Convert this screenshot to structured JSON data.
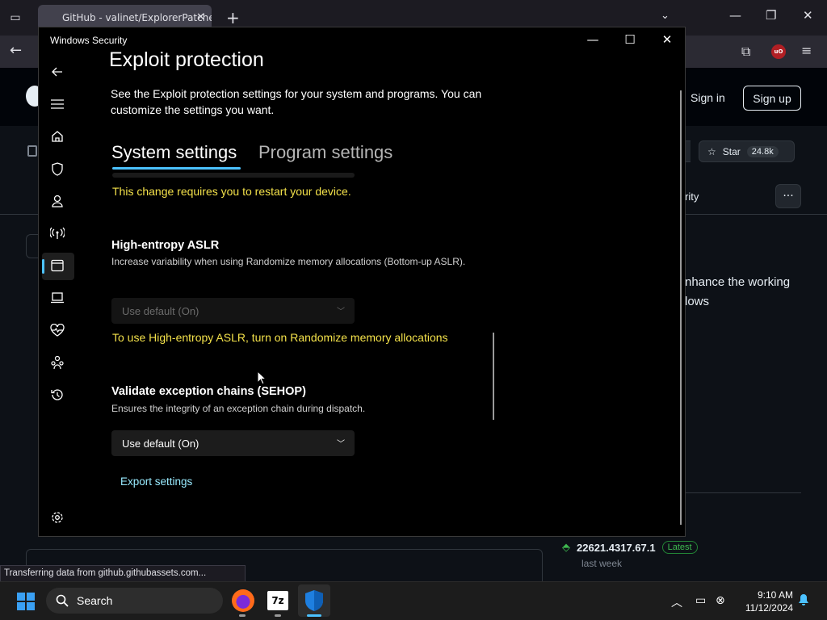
{
  "browser": {
    "tab_title": "GitHub - valinet/ExplorerPatcher",
    "tab_close": "✕",
    "new_tab": "+",
    "status_text": "Transferring data from github.githubassets.com..."
  },
  "github": {
    "signin_label": "Sign in",
    "signup_label": "Sign up",
    "star_label": "Star",
    "star_count": "24.8k",
    "partial_tab": "rity",
    "description_partial": "nhance the working lows",
    "release_version": "22621.4317.67.1",
    "release_badge": "Latest",
    "release_date": "last week"
  },
  "windows_security": {
    "window_title": "Windows Security",
    "page_title": "Exploit protection",
    "intro": "See the Exploit protection settings for your system and programs.  You can customize the settings you want.",
    "tabs": [
      {
        "label": "System settings",
        "active": true
      },
      {
        "label": "Program settings",
        "active": false
      }
    ],
    "restart_warning": "This change requires you to restart your device.",
    "settings": [
      {
        "title": "High-entropy ASLR",
        "description": "Increase variability when using Randomize memory allocations (Bottom-up ASLR).",
        "value": "Use default (On)",
        "disabled": true,
        "note": "To use High-entropy ASLR, turn on Randomize memory allocations"
      },
      {
        "title": "Validate exception chains (SEHOP)",
        "description": "Ensures the integrity of an exception chain during dispatch.",
        "value": "Use default (On)",
        "disabled": false
      }
    ],
    "export_link": "Export settings",
    "nav_icons": [
      "back-arrow-icon",
      "hamburger-menu-icon",
      "home-icon",
      "shield-icon",
      "account-icon",
      "network-icon",
      "app-browser-control-icon",
      "device-security-icon",
      "health-heart-icon",
      "family-icon",
      "history-icon",
      "settings-gear-icon"
    ]
  },
  "taskbar": {
    "search_label": "Search",
    "time": "9:10 AM",
    "date": "11/12/2024",
    "apps": [
      "firefox-icon",
      "7zip-icon",
      "windows-security-icon"
    ],
    "app_7z_label": "7z"
  },
  "colors": {
    "accent": "#4cc2ff",
    "warning": "#f3e14a",
    "link": "#99ebff",
    "window_bg": "#000000"
  }
}
